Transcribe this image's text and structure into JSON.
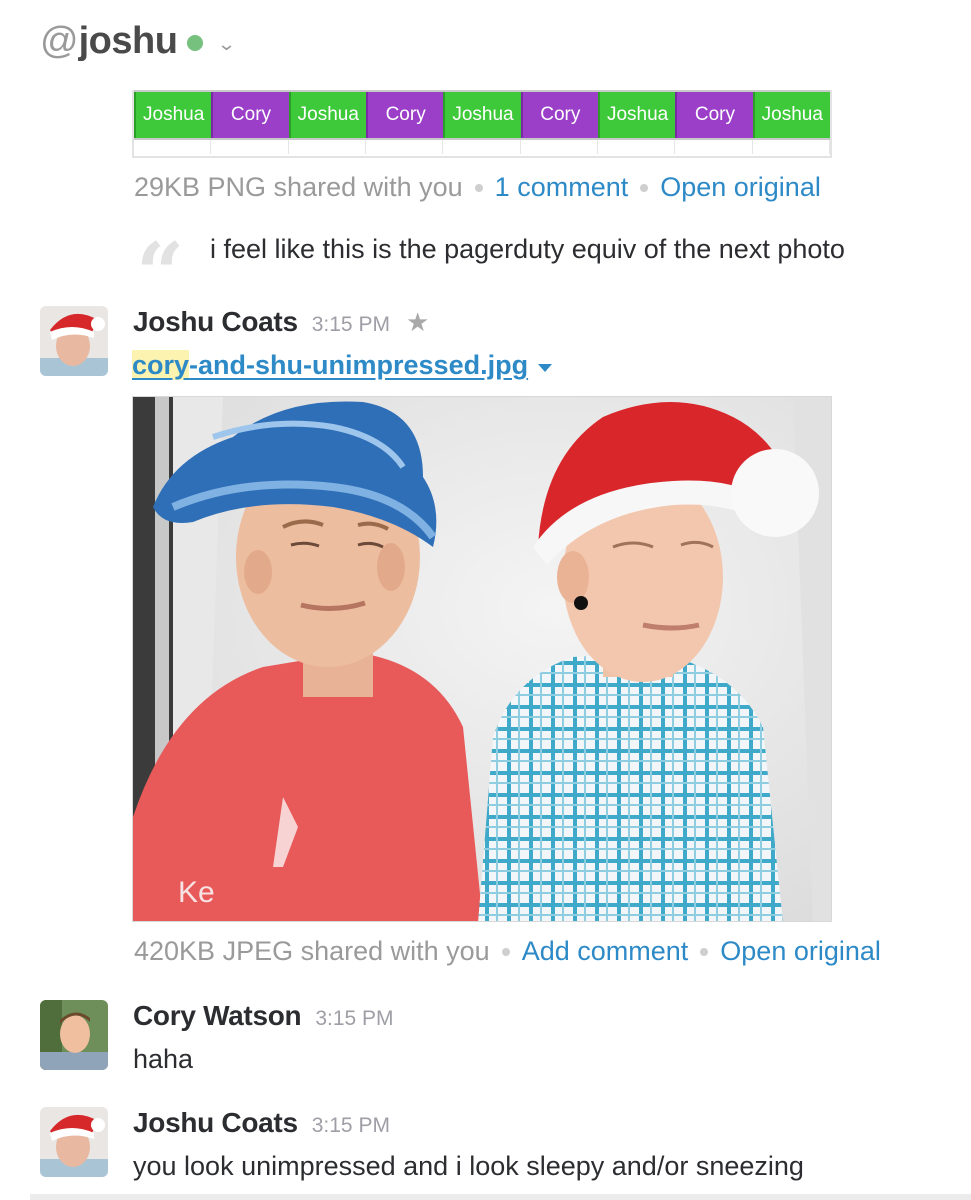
{
  "channel": {
    "prefix": "@",
    "name": "joshu",
    "presence_color": "#77c17e",
    "chevron": "⌄"
  },
  "schedule_image": {
    "cells": [
      {
        "label": "Joshua",
        "color": "green"
      },
      {
        "label": "Cory",
        "color": "purple"
      },
      {
        "label": "Joshua",
        "color": "green"
      },
      {
        "label": "Cory",
        "color": "purple"
      },
      {
        "label": "Joshua",
        "color": "green"
      },
      {
        "label": "Cory",
        "color": "purple"
      },
      {
        "label": "Joshua",
        "color": "green"
      },
      {
        "label": "Cory",
        "color": "purple"
      },
      {
        "label": "Joshua",
        "color": "green"
      }
    ],
    "meta": {
      "info": "29KB PNG shared with you",
      "comments": "1 comment",
      "open": "Open original"
    },
    "comment_text": "i feel like this is the pagerduty equiv of the next photo"
  },
  "messages": [
    {
      "sender": "Joshu Coats",
      "time": "3:15 PM",
      "file": {
        "name_highlight": "cory",
        "name_rest": "-and-shu-unimpressed.jpg",
        "meta": {
          "info": "420KB JPEG shared with you",
          "comment": "Add comment",
          "open": "Open original"
        }
      }
    },
    {
      "sender": "Cory Watson",
      "time": "3:15 PM",
      "text": "haha"
    },
    {
      "sender": "Joshu Coats",
      "time": "3:15 PM",
      "text": "you look unimpressed and i look sleepy and/or sneezing"
    }
  ],
  "icons": {
    "star": "star-icon",
    "quote": "quote-icon",
    "caret": "dropdown-caret-icon"
  },
  "colors": {
    "link": "#2d8ac7",
    "green": "#3ec93a",
    "purple": "#9b3fc9",
    "muted": "#9a9a9a"
  }
}
